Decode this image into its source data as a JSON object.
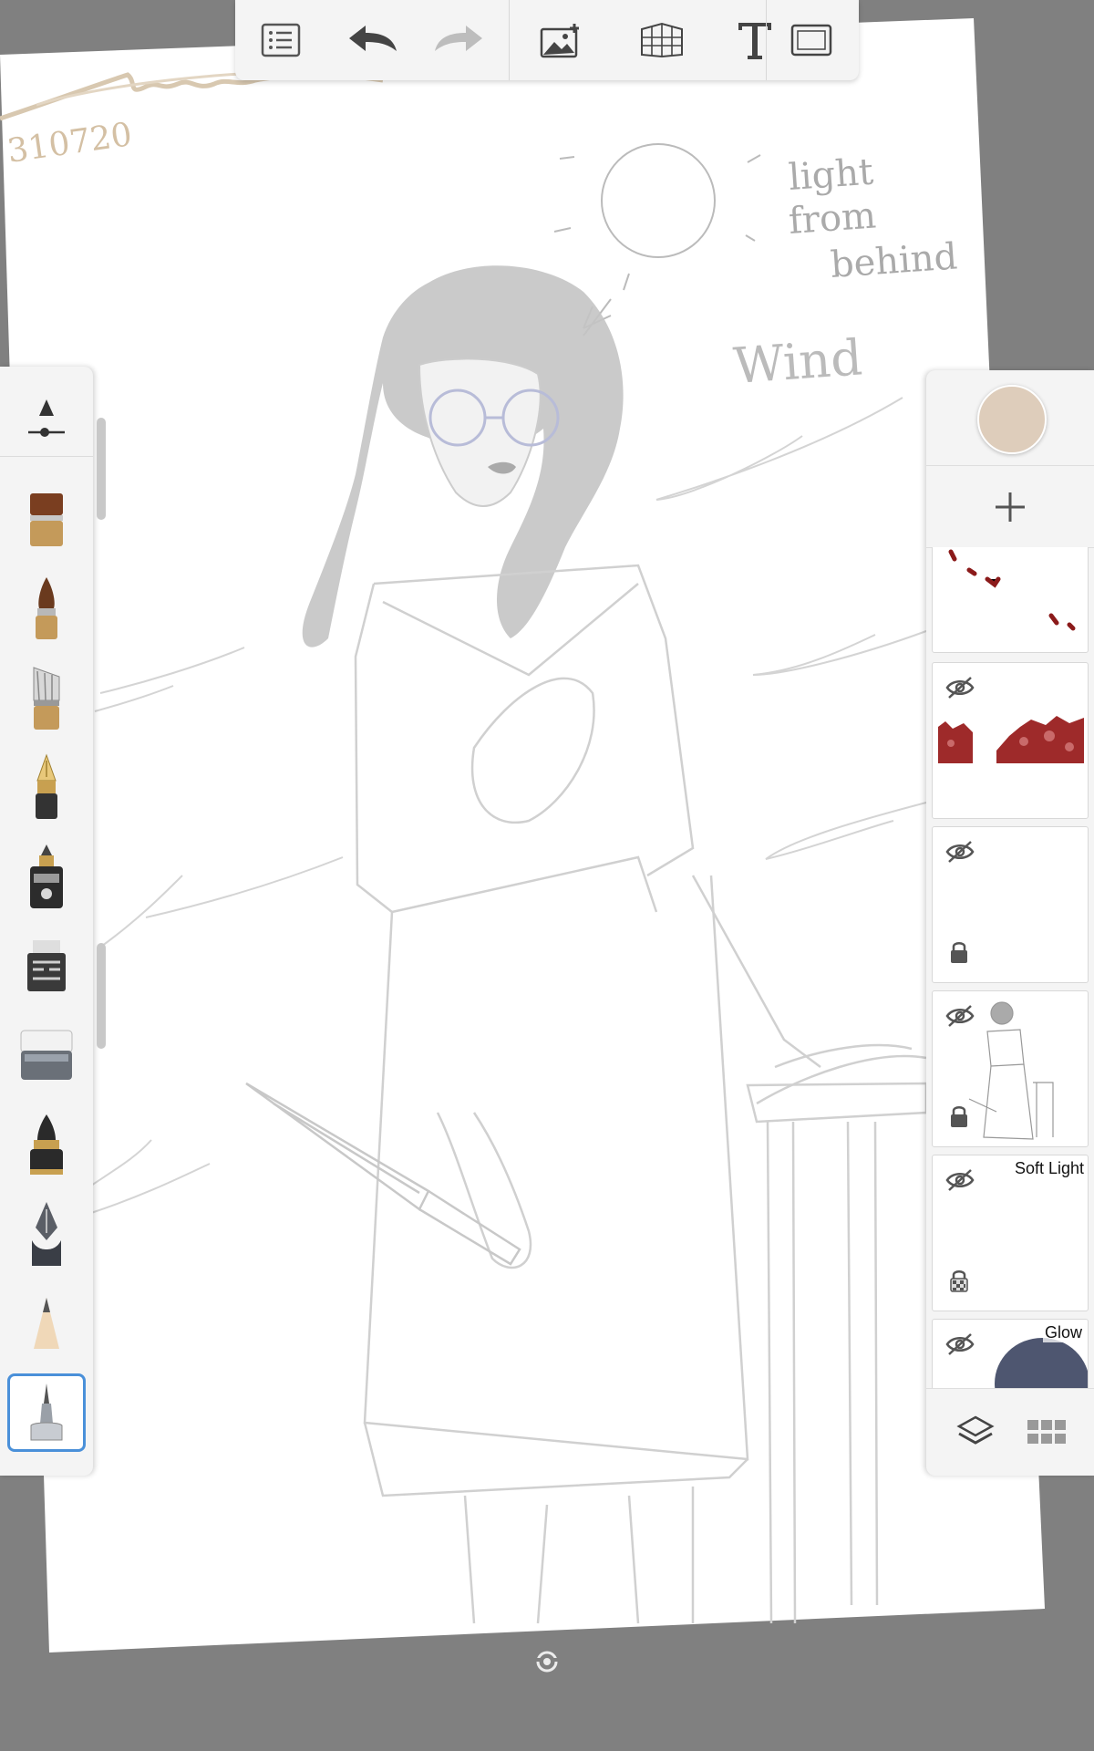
{
  "canvas": {
    "signature_date": "310720",
    "notes": [
      "light",
      "from",
      "behind",
      "Wind"
    ],
    "current_color": "#decdbb"
  },
  "toolbar": {
    "icons": [
      "list-icon",
      "undo-icon",
      "redo-icon",
      "add-image-icon",
      "perspective-grid-icon",
      "text-icon",
      "fullscreen-icon"
    ]
  },
  "brushes": {
    "items": [
      "brush-size-opacity-icon",
      "flat-brush-icon",
      "round-brush-icon",
      "fan-brush-icon",
      "fountain-pen-icon",
      "paint-marker-icon",
      "chisel-marker-icon",
      "eraser-icon",
      "ink-pen-icon",
      "nib-pen-icon",
      "pencil-icon",
      "airbrush-icon"
    ],
    "selected": "airbrush-icon"
  },
  "layers": {
    "items": [
      {
        "blend": "",
        "visible": true,
        "locked": false
      },
      {
        "blend": "",
        "visible": false,
        "locked": false
      },
      {
        "blend": "",
        "visible": false,
        "locked": true
      },
      {
        "blend": "",
        "visible": false,
        "locked": true
      },
      {
        "blend": "Soft Light",
        "visible": false,
        "locked": false,
        "transparency_locked": true
      },
      {
        "blend": "Glow",
        "visible": false,
        "locked": false
      }
    ]
  }
}
